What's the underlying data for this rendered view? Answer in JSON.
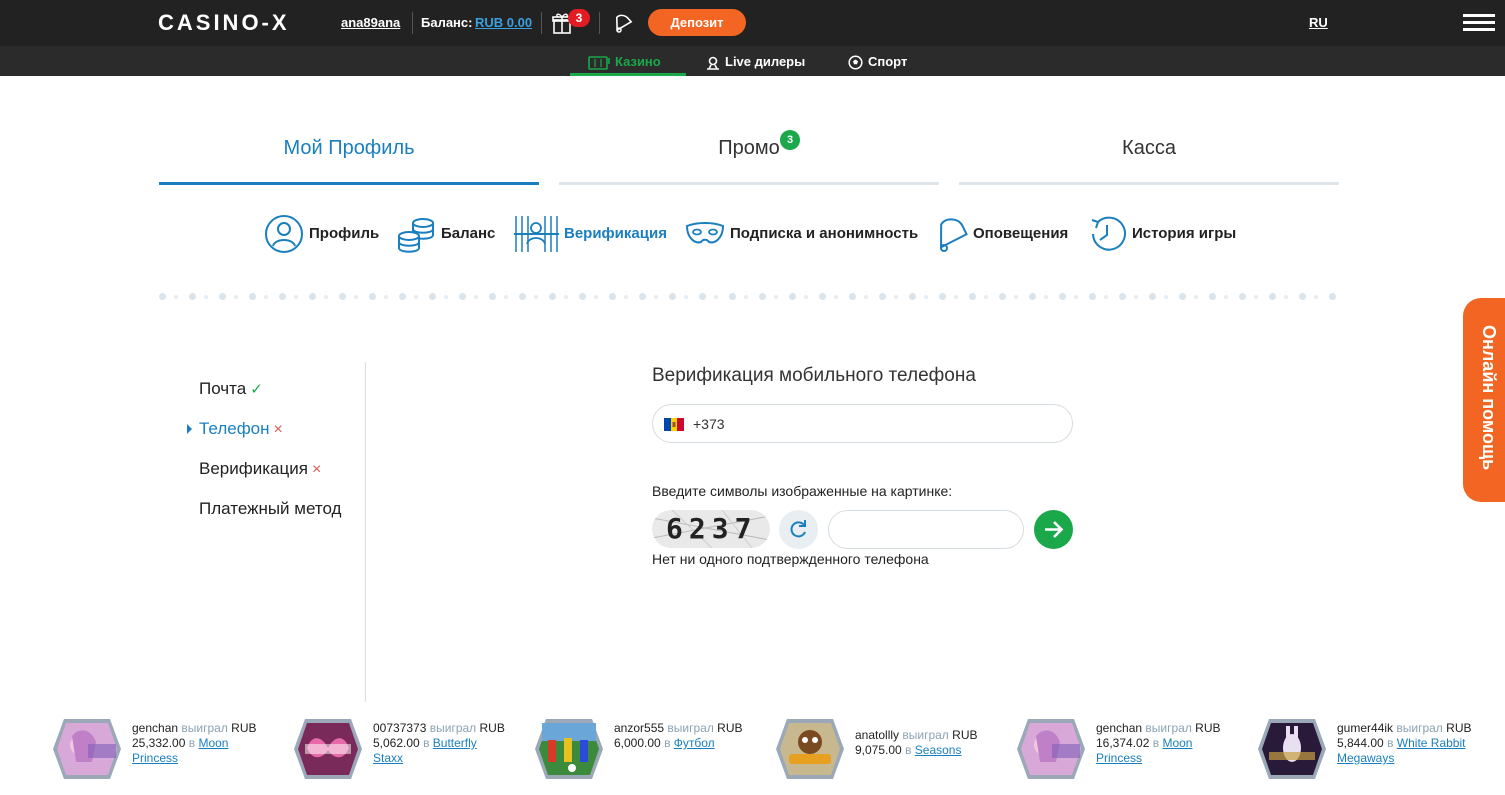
{
  "header": {
    "logo": "CASINO-X",
    "username": "ana89ana",
    "balance_label": "Баланс:",
    "balance_value": "RUB 0.00",
    "gift_count": "3",
    "deposit_label": "Депозит",
    "language": "RU"
  },
  "nav": {
    "items": [
      {
        "label": "Казино",
        "icon": "slot-icon"
      },
      {
        "label": "Live дилеры",
        "icon": "dealer-icon"
      },
      {
        "label": "Спорт",
        "icon": "football-icon"
      }
    ]
  },
  "tabs": [
    {
      "label": "Мой Профиль"
    },
    {
      "label": "Промо",
      "badge": "3"
    },
    {
      "label": "Касса"
    }
  ],
  "subnav": [
    {
      "label": "Профиль",
      "icon": "user-icon"
    },
    {
      "label": "Баланс",
      "icon": "coins-icon"
    },
    {
      "label": "Верификация",
      "icon": "verification-icon"
    },
    {
      "label": "Подписка и анонимность",
      "icon": "mask-icon"
    },
    {
      "label": "Оповещения",
      "icon": "bell-icon"
    },
    {
      "label": "История игры",
      "icon": "history-icon"
    }
  ],
  "side_menu": [
    {
      "label": "Почта",
      "mark": "✓"
    },
    {
      "label": "Телефон",
      "mark": "×"
    },
    {
      "label": "Верификация",
      "mark": "×"
    },
    {
      "label": "Платежный метод",
      "mark": ""
    }
  ],
  "verification": {
    "title": "Верификация мобильного телефона",
    "phone_prefix": "+373",
    "captcha_label": "Введите символы изображенные на картинке:",
    "captcha_text": "6237",
    "captcha_value": "",
    "no_phone_text": "Нет ни одного подтвержденного телефона"
  },
  "help": {
    "label": "Онлайн помощь"
  },
  "winners": [
    {
      "user": "genchan",
      "won": "выиграл",
      "currency": "RUB",
      "amount": "25,332.00",
      "in": "в",
      "game_a": "Moon",
      "game_b": "Princess",
      "thumb": "moon-princess"
    },
    {
      "user": "00737373",
      "won": "выиграл",
      "currency": "RUB",
      "amount": "5,062.00",
      "in": "в",
      "game_a": "Butterfly",
      "game_b": "Staxx",
      "thumb": "butterfly"
    },
    {
      "user": "anzor555",
      "won": "выиграл",
      "currency": "RUB",
      "amount": "6,000.00",
      "in": "в",
      "game_a": "Футбол",
      "game_b": "",
      "thumb": "football"
    },
    {
      "user": "anatollly",
      "won": "выиграл",
      "currency": "RUB",
      "amount": "9,075.00",
      "in": "в",
      "game_a": "Seasons",
      "game_b": "",
      "thumb": "seasons"
    },
    {
      "user": "genchan",
      "won": "выиграл",
      "currency": "RUB",
      "amount": "16,374.02",
      "in": "в",
      "game_a": "Moon",
      "game_b": "Princess",
      "thumb": "moon-princess"
    },
    {
      "user": "gumer44ik",
      "won": "выиграл",
      "currency": "RUB",
      "amount": "5,844.00",
      "in": "в",
      "game_a": "White Rabbit",
      "game_b": "Megaways",
      "thumb": "white-rabbit"
    }
  ],
  "colors": {
    "accent": "#1a7fbf",
    "deposit": "#f26522",
    "success": "#1aa84b",
    "error": "#e05a4e",
    "topbar": "#222222"
  }
}
